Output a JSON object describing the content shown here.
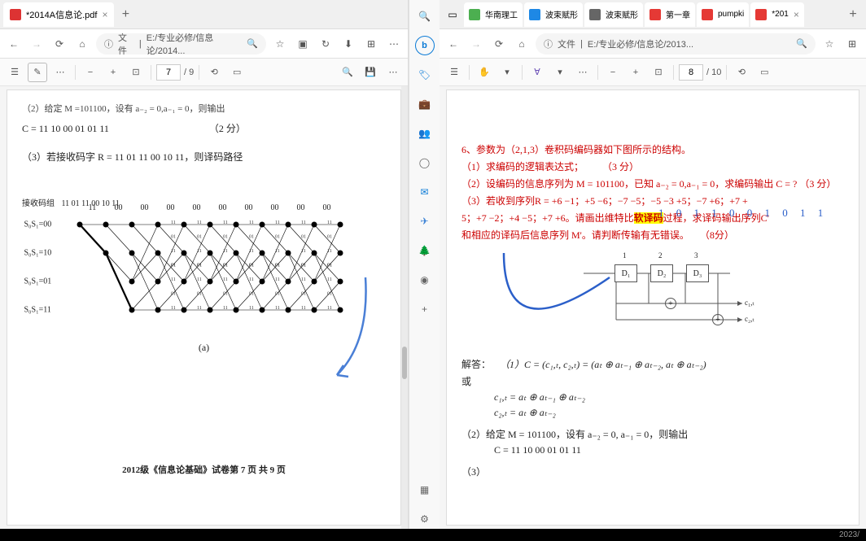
{
  "left": {
    "tab_title": "*2014A信息论.pdf",
    "url_prefix": "文件",
    "url": "E:/专业必修/信息论/2014...",
    "page_current": "7",
    "page_total": "/ 9",
    "content": {
      "line_top": "（2）给定 M =101100，设有 a₋₂ = 0,a₋₁ = 0，则输出",
      "c_line": "C = 11  10   00  01  01  11",
      "c_score": "（2 分）",
      "q3": "（3）若接收码字 R = 11  01  11  00  10  11，则译码路径",
      "recv_label": "接收码组",
      "recv_bits": "11 01 11 00 10 11",
      "states": [
        "S₀S₁=00",
        "S₀S₁=10",
        "S₀S₁=01",
        "S₀S₁=11"
      ],
      "top_bits": [
        "11",
        "00",
        "00",
        "00",
        "00",
        "00",
        "00",
        "00",
        "00",
        "00"
      ],
      "fig_label": "(a)",
      "footer": "2012级《信息论基础》试卷第 7 页 共 9 页"
    }
  },
  "right": {
    "tabs": [
      {
        "icon": "#4caf50",
        "label": "华南理工"
      },
      {
        "icon": "#1e88e5",
        "label": "波束赋形"
      },
      {
        "icon": "#666",
        "label": "波束赋形"
      },
      {
        "icon": "#e53935",
        "label": "第一章"
      },
      {
        "icon": "#e53935",
        "label": "pumpki"
      },
      {
        "icon": "#e53935",
        "label": "*201"
      }
    ],
    "url_prefix": "文件",
    "url": "E:/专业必修/信息论/2013...",
    "page_current": "8",
    "page_total": "/ 10",
    "content": {
      "q6": "6、参数为（2,1,3）卷积码编码器如下图所示的结构。",
      "q6_1": "（1）求编码的逻辑表达式；",
      "q6_1_score": "（3 分）",
      "q6_2_pre": "（2）设编码的信息序列为 M = 101100，已知 a₋₂ = 0,a₋₁ = 0，求编码输出 C = ?",
      "q6_2_score": "（3 分）",
      "ann_digits": "1 0  1  1   0   0   1  0  1  1",
      "q6_3": "（3）若收到序列R =  +6  −1；+5  −6；−7  −5；−5  −3  +5；−7  +6；+7  +",
      "q6_3b": "5；+7  −2；+4  −5；+7  +6。请画出维特比",
      "q6_3_hl": "软译码",
      "q6_3c": "过程，求译码输出序列C'",
      "q6_3d": "和相应的译码后信息序列 M'。请判断传输有无错误。",
      "q6_3_score": "（8分）",
      "boxes": [
        "D₁",
        "D₂",
        "D₃"
      ],
      "box_nums": [
        "1",
        "2",
        "3"
      ],
      "out_labels": [
        "c₁,ₜ",
        "c₂,ₜ"
      ],
      "ans_label": "解答：",
      "ans1": "（1）C = (c₁,ₜ, c₂,ₜ) = (aₜ ⊕ aₜ₋₁ ⊕ aₜ₋₂, aₜ ⊕ aₜ₋₂)",
      "or": "或",
      "ans1b": "c₁,ₜ = aₜ ⊕ aₜ₋₁ ⊕ aₜ₋₂",
      "ans1c": "c₂,ₜ = aₜ ⊕ aₜ₋₂",
      "ans2": "（2）给定 M = 101100，设有 a₋₂ = 0, a₋₁ = 0，则输出",
      "ans2b": "C = 11  10   00  01  01  11",
      "ans3": "（3）"
    }
  },
  "footer_date": "2023/",
  "icons": {
    "search": "🔍",
    "bing": "b",
    "tag": "🏷",
    "briefcase": "💼",
    "person": "👤",
    "circle": "◯",
    "outlook": "✉",
    "plane": "✈",
    "tree": "🌲",
    "eye": "👁",
    "plus": "+",
    "gear": "⚙",
    "grid": "▦"
  }
}
